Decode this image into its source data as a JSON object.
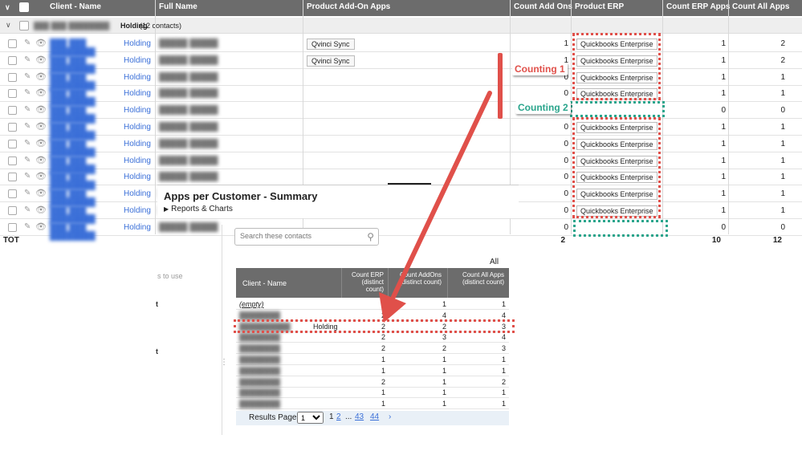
{
  "header": {
    "cols": [
      "Client - Name",
      "Full Name",
      "Product Add-On Apps",
      "Count Add Ons",
      "Product ERP",
      "Count ERP Apps",
      "Count All Apps"
    ]
  },
  "group": {
    "name_bold": "Holding",
    "count_text": "(12 contacts)"
  },
  "rows": [
    {
      "client": "Holding",
      "addon": "Qvinci Sync",
      "cao": "1",
      "erp": "Quickbooks Enterprise",
      "cerp": "1",
      "call": "2"
    },
    {
      "client": "Holding",
      "addon": "Qvinci Sync",
      "cao": "1",
      "erp": "Quickbooks Enterprise",
      "cerp": "1",
      "call": "2"
    },
    {
      "client": "Holding",
      "addon": "",
      "cao": "0",
      "erp": "Quickbooks Enterprise",
      "cerp": "1",
      "call": "1"
    },
    {
      "client": "Holding",
      "addon": "",
      "cao": "0",
      "erp": "Quickbooks Enterprise",
      "cerp": "1",
      "call": "1"
    },
    {
      "client": "Holding",
      "addon": "",
      "cao": "0",
      "erp": "",
      "cerp": "0",
      "call": "0"
    },
    {
      "client": "Holding",
      "addon": "",
      "cao": "0",
      "erp": "Quickbooks Enterprise",
      "cerp": "1",
      "call": "1"
    },
    {
      "client": "Holding",
      "addon": "",
      "cao": "0",
      "erp": "Quickbooks Enterprise",
      "cerp": "1",
      "call": "1"
    },
    {
      "client": "Holding",
      "addon": "",
      "cao": "0",
      "erp": "Quickbooks Enterprise",
      "cerp": "1",
      "call": "1"
    },
    {
      "client": "Holding",
      "addon": "",
      "cao": "0",
      "erp": "Quickbooks Enterprise",
      "cerp": "1",
      "call": "1"
    },
    {
      "client": "Holding",
      "addon": "",
      "cao": "0",
      "erp": "Quickbooks Enterprise",
      "cerp": "1",
      "call": "1"
    },
    {
      "client": "Holding",
      "addon": "",
      "cao": "0",
      "erp": "Quickbooks Enterprise",
      "cerp": "1",
      "call": "1"
    },
    {
      "client": "Holding",
      "addon": "",
      "cao": "0",
      "erp": "",
      "cerp": "0",
      "call": "0"
    }
  ],
  "totals": {
    "label": "TOT",
    "cao": "2",
    "cerp": "10",
    "call": "12"
  },
  "annotations": {
    "counting1": "Counting 1",
    "counting2": "Counting 2",
    "red": "#e0504a",
    "teal": "#2aa58c"
  },
  "summary": {
    "title": "Apps per Customer - Summary",
    "sub": "Reports & Charts",
    "search_placeholder": "Search these contacts",
    "all_label": "All",
    "left_text1": "s to use",
    "left_text2": "t",
    "left_text3": "t",
    "table": {
      "headers": [
        "Client - Name",
        "Count ERP (distinct count)",
        "Count AddOns (distinct count)",
        "Count All Apps (distinct count)"
      ],
      "rows": [
        {
          "name": "(empty)",
          "c1": "",
          "c2": "1",
          "c3": "1"
        },
        {
          "name": "",
          "c1": "2",
          "c2": "4",
          "c3": "4"
        },
        {
          "name": "Holding",
          "c1": "2",
          "c2": "2",
          "c3": "3"
        },
        {
          "name": "",
          "c1": "2",
          "c2": "3",
          "c3": "4"
        },
        {
          "name": "",
          "c1": "2",
          "c2": "2",
          "c3": "3"
        },
        {
          "name": "",
          "c1": "1",
          "c2": "1",
          "c3": "1"
        },
        {
          "name": "",
          "c1": "1",
          "c2": "1",
          "c3": "1"
        },
        {
          "name": "",
          "c1": "2",
          "c2": "1",
          "c3": "2"
        },
        {
          "name": "",
          "c1": "1",
          "c2": "1",
          "c3": "1"
        },
        {
          "name": "",
          "c1": "1",
          "c2": "1",
          "c3": "1"
        }
      ]
    },
    "pager": {
      "label": "Results Page:",
      "select_value": "1",
      "current": "1",
      "p2": "2",
      "ellipsis": "...",
      "p43": "43",
      "p44": "44",
      "next": "›"
    }
  }
}
